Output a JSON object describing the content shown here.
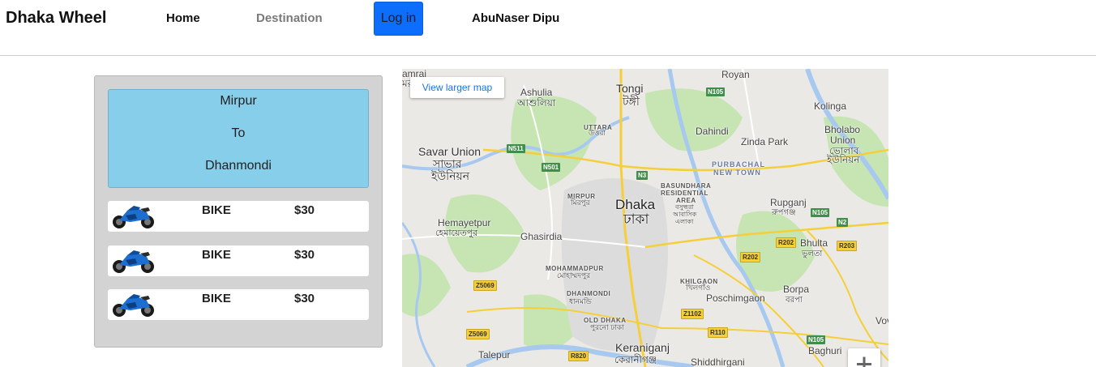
{
  "navbar": {
    "brand": "Dhaka Wheel",
    "home": "Home",
    "destination": "Destination",
    "login": "Log in",
    "user": "AbuNaser Dipu"
  },
  "route": {
    "from": "Mirpur",
    "to": "To",
    "destination": "Dhanmondi"
  },
  "rides": [
    {
      "type": "BIKE",
      "price": "$30",
      "icon": "motorbike-image"
    },
    {
      "type": "BIKE",
      "price": "$30",
      "icon": "motorbike-image"
    },
    {
      "type": "BIKE",
      "price": "$30",
      "icon": "motorbike-image"
    }
  ],
  "map": {
    "larger_map_link": "View larger map",
    "zoom_in": "+",
    "labels": {
      "amrai": "amrai",
      "amrai_bn": "মরাই",
      "ashulia": "Ashulia",
      "ashulia_bn": "আশুলিয়া",
      "tongi": "Tongi",
      "tongi_bn": "টঙ্গী",
      "royan": "Royan",
      "kolinga": "Kolinga",
      "uttara": "UTTARA",
      "uttara_bn": "উত্তরা",
      "dahindi": "Dahindi",
      "bholabo": "Bholabo",
      "union": "Union",
      "bholabo_bn": "ভোলাব",
      "union_bn": "ইউনিয়ন",
      "savar": "Savar Union",
      "savar_bn1": "সাভার",
      "savar_bn2": "ইউনিয়ন",
      "zinda": "Zinda Park",
      "purbachal1": "PURBACHAL",
      "purbachal2": "NEW TOWN",
      "mirpur": "MIRPUR",
      "mirpur_bn": "মিরপুর",
      "dhaka": "Dhaka",
      "dhaka_bn": "ঢাকা",
      "bashundhara1": "BASUNDHARA",
      "bashundhara2": "RESIDENTIAL",
      "bashundhara3": "AREA",
      "bashundhara_bn1": "বসুন্ধরা",
      "bashundhara_bn2": "আবাসিক",
      "bashundhara_bn3": "এলাকা",
      "rupganj": "Rupganj",
      "rupganj_bn": "রুপগঞ্জ",
      "hemayetpur": "Hemayetpur",
      "hemayetpur_bn": "হেমায়েতপুর",
      "ghasirdia": "Ghasirdia",
      "bhulta": "Bhulta",
      "bhulta_bn": "ভুলতা",
      "mohammadpur": "MOHAMMADPUR",
      "mohammadpur_bn": "মোহাম্মদপুর",
      "khilgaon": "KHILGAON",
      "khilgaon_bn": "খিলগাঁও",
      "dhanmondi": "DHANMONDI",
      "dhanmondi_bn": "ধানমন্ডি",
      "poschimgaon": "Poschimgaon",
      "borpa": "Borpa",
      "borpa_bn": "বরপা",
      "old_dhaka": "OLD DHAKA",
      "old_dhaka_bn": "পুরনো ঢাকা",
      "vov": "Vov",
      "talepur": "Talepur",
      "keraniganj": "Keraniganj",
      "keraniganj_bn": "কেরানীগঞ্জ",
      "shiddhirganj": "Shiddhirgani",
      "baghuri": "Baghuri"
    },
    "shields": {
      "n105a": "N105",
      "n511": "N511",
      "n501": "N501",
      "n3": "N3",
      "n105b": "N105",
      "n2": "N2",
      "r202a": "R202",
      "r203": "R203",
      "r202b": "R202",
      "z5069a": "Z5069",
      "z1102": "Z1102",
      "r110": "R110",
      "z5069b": "Z5069",
      "r820": "R820",
      "n105c": "N105"
    }
  },
  "colors": {
    "login_bg": "#0d6efd",
    "route_bg": "#87ceeb",
    "panel_bg": "#d3d3d3",
    "map_water": "#a7c9f0",
    "map_park": "#c6e5b3",
    "map_road": "#f5cf3a"
  }
}
